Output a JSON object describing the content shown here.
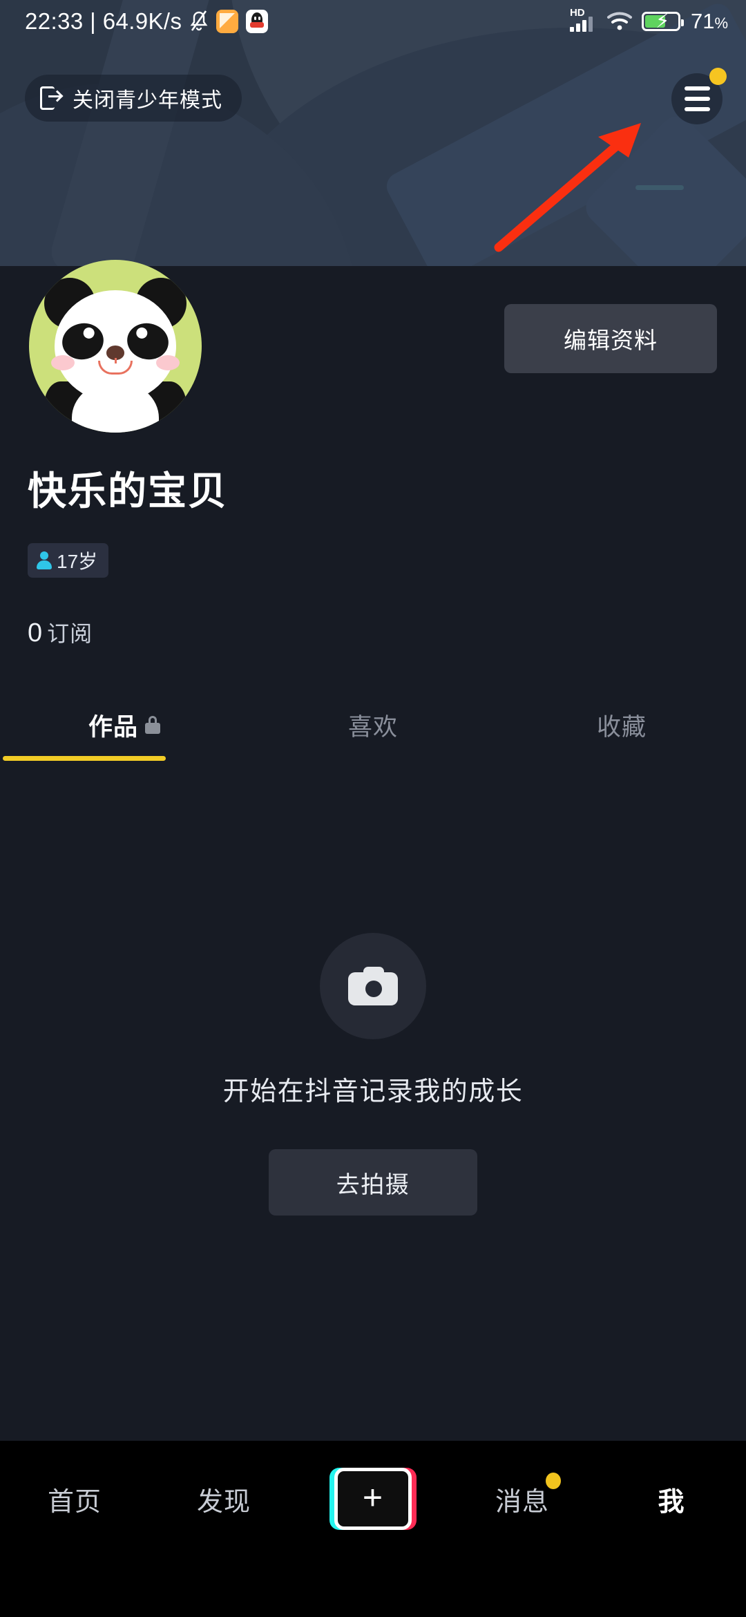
{
  "status_bar": {
    "time_and_speed": "22:33 | 64.9K/s",
    "icons": [
      "mute-bell-icon",
      "notes-app-icon",
      "qq-app-icon",
      "hd-signal-icon",
      "wifi-icon",
      "battery-charging-icon"
    ],
    "network_type": "HD",
    "battery_percent": "71",
    "battery_unit": "%"
  },
  "header": {
    "teen_mode_label": "关闭青少年模式",
    "teen_mode_icon": "exit-door-icon",
    "menu_icon": "hamburger-menu-icon",
    "menu_has_badge": true,
    "annotation_arrow_color": "#fa2f10"
  },
  "profile": {
    "avatar_icon": "panda-avatar",
    "avatar_bg_color": "#cce07b",
    "edit_button_label": "编辑资料",
    "username": "快乐的宝贝",
    "age_badge_icon": "person-icon",
    "age_badge_text": "17岁",
    "subscription_count": "0",
    "subscription_label": "订阅"
  },
  "tabs": {
    "items": [
      {
        "label": "作品",
        "icon": "lock-icon",
        "active": true
      },
      {
        "label": "喜欢",
        "icon": "",
        "active": false
      },
      {
        "label": "收藏",
        "icon": "",
        "active": false
      }
    ],
    "active_underline_color": "#f2cc26"
  },
  "empty_state": {
    "icon": "camera-icon",
    "message": "开始在抖音记录我的成长",
    "button_label": "去拍摄"
  },
  "bottom_nav": {
    "items": [
      {
        "label": "首页",
        "active": false,
        "badge": false
      },
      {
        "label": "发现",
        "active": false,
        "badge": false
      },
      {
        "label": "消息",
        "active": false,
        "badge": true
      },
      {
        "label": "我",
        "active": true,
        "badge": false
      }
    ],
    "create_icon": "plus-icon",
    "create_sign": "+",
    "accent_cyan": "#25f4ee",
    "accent_pink": "#fe2c55"
  },
  "colors": {
    "page_bg": "#171b24",
    "header_bg": "#2c3747",
    "nav_bg": "#000000",
    "badge_yellow": "#f2c41e"
  }
}
